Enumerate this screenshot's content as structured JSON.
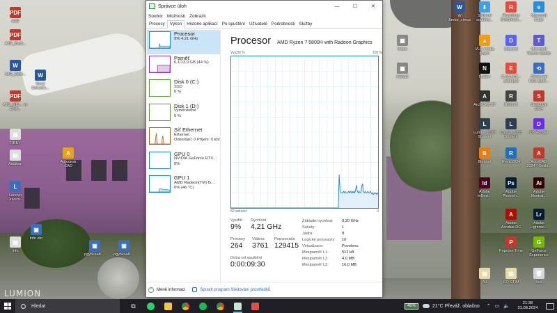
{
  "window": {
    "title": "Správce úloh",
    "menu": [
      "Soubor",
      "Možnosti",
      "Zobrazit"
    ],
    "tabs": [
      "Procesy",
      "Výkon",
      "Historie aplikací",
      "Po spuštění",
      "Uživatelé",
      "Podrobnosti",
      "Služby"
    ],
    "active_tab": "Výkon"
  },
  "resources": [
    {
      "name": "Procesor",
      "sub1": "9% 4,21 GHz",
      "sub2": "",
      "color": "#1a84c8",
      "selected": true
    },
    {
      "name": "Paměť",
      "sub1": "6,1/13,9 GB (44 %)",
      "sub2": "",
      "color": "#8b2ea6",
      "selected": false
    },
    {
      "name": "Disk 0 (C:)",
      "sub1": "SSD",
      "sub2": "0 %",
      "color": "#4d9c2d",
      "selected": false
    },
    {
      "name": "Disk 1 (D:)",
      "sub1": "Vyměnitelné",
      "sub2": "0 %",
      "color": "#4d9c2d",
      "selected": false
    },
    {
      "name": "Síť Ethernet",
      "sub1": "Ethernet",
      "sub2": "Odesílání: 0 Příjem: 0 kb/s",
      "color": "#a9581c",
      "selected": false
    },
    {
      "name": "GPU 0",
      "sub1": "NVIDIA GeForce RTX...",
      "sub2": "0%",
      "color": "#1a84c8",
      "selected": false
    },
    {
      "name": "GPU 1",
      "sub1": "AMD Radeon(TM) G...",
      "sub2": "0% (46 °C)",
      "color": "#1a84c8",
      "selected": false
    }
  ],
  "cpu": {
    "title": "Procesor",
    "model": "AMD Ryzen 7 5800H with Radeon Graphics",
    "axis_top_left": "Využití %",
    "axis_top_right": "100 %",
    "axis_bottom_left": "60 sekund",
    "axis_bottom_right": "0",
    "usage_label": "Využití",
    "usage": "9%",
    "speed_label": "Rychlost",
    "speed": "4,21 GHz",
    "processes_label": "Procesy",
    "processes": "264",
    "threads_label": "Vlákna",
    "threads": "3761",
    "handles_label": "Popisovače",
    "handles": "129415",
    "uptime_label": "Doba od spuštění",
    "uptime": "0:00:09:30",
    "specs": [
      {
        "k": "Základní rychlost:",
        "v": "3,20 GHz"
      },
      {
        "k": "Sokety:",
        "v": "1"
      },
      {
        "k": "Jádra:",
        "v": "8"
      },
      {
        "k": "Logické procesory:",
        "v": "16"
      },
      {
        "k": "Virtualizace:",
        "v": "Povoleno"
      },
      {
        "k": "Mezipaměť L1:",
        "v": "512 kB"
      },
      {
        "k": "Mezipaměť L2:",
        "v": "4,0 MB"
      },
      {
        "k": "Mezipaměť L3:",
        "v": "16,0 MB"
      }
    ],
    "history_percent": [
      0,
      0,
      0,
      0,
      0,
      0,
      0,
      0,
      0,
      0,
      0,
      0,
      0,
      0,
      0,
      0,
      0,
      0,
      0,
      0,
      0,
      0,
      0,
      0,
      0,
      0,
      0,
      0,
      0,
      0,
      0,
      0,
      0,
      0,
      0,
      0,
      0,
      0,
      0,
      0,
      0,
      0,
      0,
      0,
      0,
      0,
      0,
      0,
      0,
      0,
      0,
      0,
      0,
      0,
      0,
      0,
      0,
      0,
      0,
      0,
      0,
      0,
      0,
      0,
      0,
      0,
      0,
      0,
      0,
      0,
      0,
      0,
      0,
      0,
      0,
      0,
      0,
      0,
      0,
      0,
      0,
      0,
      0,
      0,
      0,
      0,
      0,
      0,
      0,
      0,
      0,
      0,
      0,
      0,
      0,
      0,
      0,
      0,
      0,
      0,
      0,
      0,
      0,
      0,
      0,
      0,
      0,
      0,
      0,
      0,
      0,
      0,
      0,
      0,
      0,
      0,
      0,
      0,
      0,
      0,
      0,
      0,
      0,
      0,
      0,
      22,
      12,
      10,
      10,
      10,
      11,
      10,
      11,
      10,
      10,
      10,
      11,
      10,
      11,
      10,
      11,
      10,
      11,
      10,
      12,
      15,
      11,
      10,
      11,
      10,
      10,
      14,
      16,
      11,
      10,
      11,
      10,
      10,
      11,
      10,
      10,
      11,
      10,
      9,
      10,
      9,
      10,
      10,
      9,
      10,
      9
    ]
  },
  "footer": {
    "less": "Méně informací",
    "monitor": "Spustit program Sledování prostředků"
  },
  "desktop_icons": [
    {
      "label": "AJG",
      "color": "#c0392b",
      "glyph": "PDF"
    },
    {
      "label": "AJG_Zesli...",
      "color": "#c0392b",
      "glyph": "PDF"
    },
    {
      "label": "AJG_Zesli...",
      "color": "#2b579a",
      "glyph": "W"
    },
    {
      "label": "Nový Dokume...",
      "color": "#2b579a",
      "glyph": "W"
    },
    {
      "label": "AJG_MIU... ve Zesli...",
      "color": "#c0392b",
      "glyph": "PDF"
    },
    {
      "label": "FIBEY",
      "color": "#dddddd",
      "glyph": "▤"
    },
    {
      "label": "Addition",
      "color": "#dddddd",
      "glyph": "▤"
    },
    {
      "label": "Autodesk CAD",
      "color": "#e8a317",
      "glyph": "A"
    },
    {
      "label": "Lenovo Drivers...",
      "color": "#3a6fbf",
      "glyph": "L"
    },
    {
      "label": "Info",
      "color": "#dddddd",
      "glyph": "▤"
    },
    {
      "label": "Info obr",
      "color": "#3a6fbf",
      "glyph": "▣"
    },
    {
      "label": "pgy5ksa8 ...",
      "color": "#3a6fbf",
      "glyph": "▣"
    },
    {
      "label": "pgy5ksa8 ...",
      "color": "#3a6fbf",
      "glyph": "▣"
    },
    {
      "label": "W Jirebe_zimus",
      "color": "#2b579a",
      "glyph": "W"
    },
    {
      "label": "Stažené soubory...",
      "color": "#3ea1e5",
      "glyph": "⬇"
    },
    {
      "label": "Rapidflow Dokument...",
      "color": "#e74c3c",
      "glyph": "R"
    },
    {
      "label": "Microsoft Edge",
      "color": "#2a8fd9",
      "glyph": "e"
    },
    {
      "label": "Inbox",
      "color": "#888888",
      "glyph": "▦"
    },
    {
      "label": "VLC media player",
      "color": "#f39c12",
      "glyph": "▲"
    },
    {
      "label": "Discord",
      "color": "#5865f2",
      "glyph": "D"
    },
    {
      "label": "Microsoft Teams classic",
      "color": "#5b5fc7",
      "glyph": "T"
    },
    {
      "label": "Inbox2",
      "color": "#888888",
      "glyph": "▦"
    },
    {
      "label": "Notion",
      "color": "#111111",
      "glyph": "N"
    },
    {
      "label": "E-SCAPE - zástupce",
      "color": "#e74c3c",
      "glyph": "E"
    },
    {
      "label": "Obnovení Kelo zpuš...",
      "color": "#3a6fbf",
      "glyph": "⟲"
    },
    {
      "label": "ArchiCAD 27",
      "color": "#333333",
      "glyph": "A"
    },
    {
      "label": "Rhino 8",
      "color": "#444444",
      "glyph": "R"
    },
    {
      "label": "SketchUp 2024",
      "color": "#c0392b",
      "glyph": "S"
    },
    {
      "label": "Lumion 2023 Student",
      "color": "#2c3e50",
      "glyph": "L"
    },
    {
      "label": "Lumion 12.5 Student",
      "color": "#2c3e50",
      "glyph": "L"
    },
    {
      "label": "D5 Render",
      "color": "#6a2cf5",
      "glyph": "D"
    },
    {
      "label": "Blender",
      "color": "#e87d0d",
      "glyph": "B"
    },
    {
      "label": "Revit 2024",
      "color": "#1f6fbf",
      "glyph": "R"
    },
    {
      "label": "AutoCAD 2024 - Ceski...",
      "color": "#c0392b",
      "glyph": "A"
    },
    {
      "label": "Adobe InDesi...",
      "color": "#49021f",
      "glyph": "Id"
    },
    {
      "label": "Adobe Photosh...",
      "color": "#001e36",
      "glyph": "Ps"
    },
    {
      "label": "Adobe Illustrat...",
      "color": "#330000",
      "glyph": "Ai"
    },
    {
      "label": "Adobe Acrobat DC",
      "color": "#b30b00",
      "glyph": "A"
    },
    {
      "label": "Adobe Lightroo...",
      "color": "#001d34",
      "glyph": "Lr"
    },
    {
      "label": "Popcorn Time",
      "color": "#c0392b",
      "glyph": "P"
    },
    {
      "label": "GeForce Experience",
      "color": "#76b900",
      "glyph": "G"
    },
    {
      "label": "AJ",
      "color": "#e8d9a8",
      "glyph": "▤"
    },
    {
      "label": "CO STIM",
      "color": "#e8d9a8",
      "glyph": "▤"
    },
    {
      "label": "Koš",
      "color": "#cfd8dc",
      "glyph": "🗑"
    }
  ],
  "wallpaper_text": "LUMION",
  "taskbar": {
    "search": "Hledat",
    "battery": "46%",
    "weather": "21°C  Převáž. oblačno",
    "time": "21:38",
    "date": "21.08.2024"
  }
}
